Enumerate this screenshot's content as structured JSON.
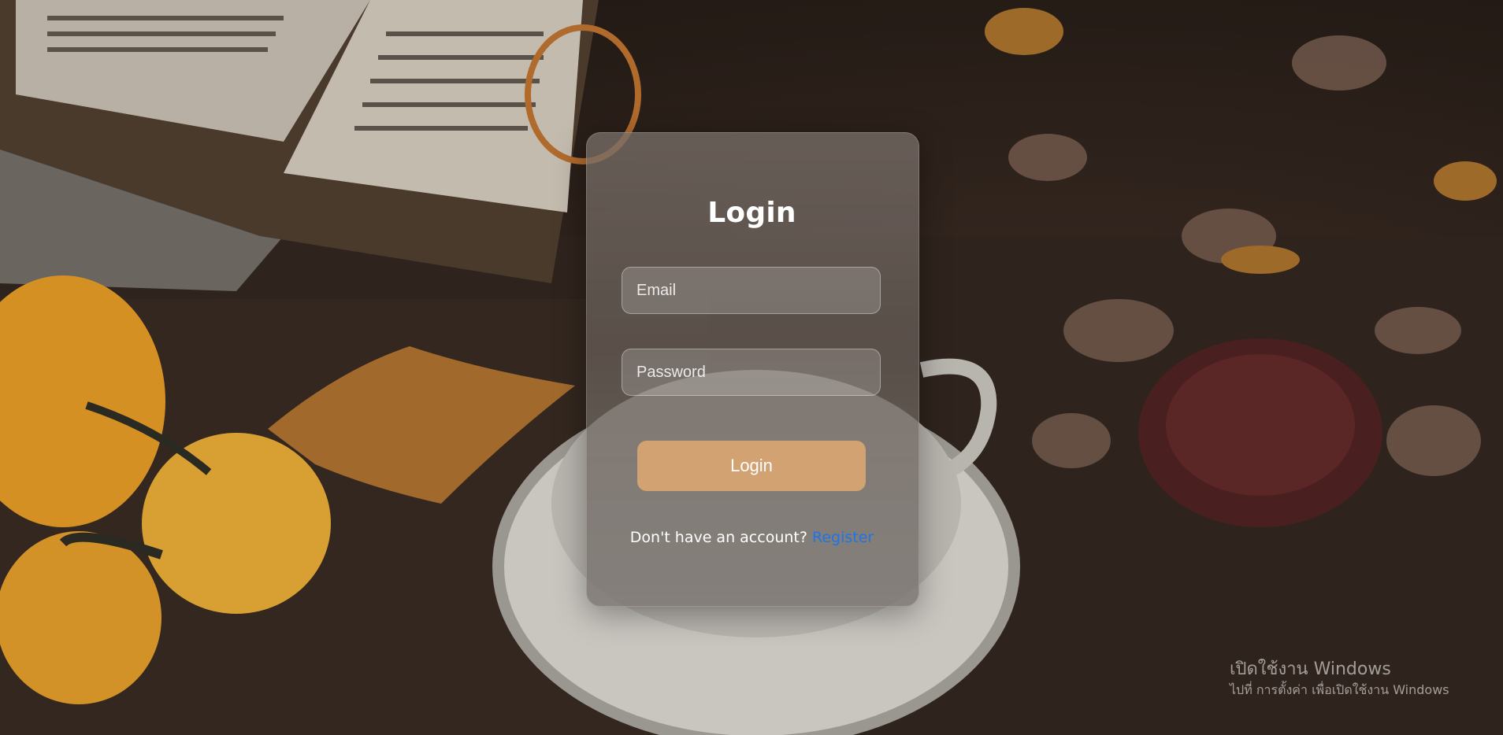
{
  "login_form": {
    "title": "Login",
    "email_placeholder": "Email",
    "password_placeholder": "Password",
    "submit_label": "Login",
    "register_prompt": "Don't have an account?",
    "register_link": "Register"
  },
  "windows_watermark": {
    "title": "เปิดใช้งาน Windows",
    "subtitle": "ไปที่ การตั้งค่า เพื่อเปิดใช้งาน Windows"
  },
  "colors": {
    "button": "#d3a273",
    "link": "#1e74e8",
    "text": "#ffffff"
  }
}
